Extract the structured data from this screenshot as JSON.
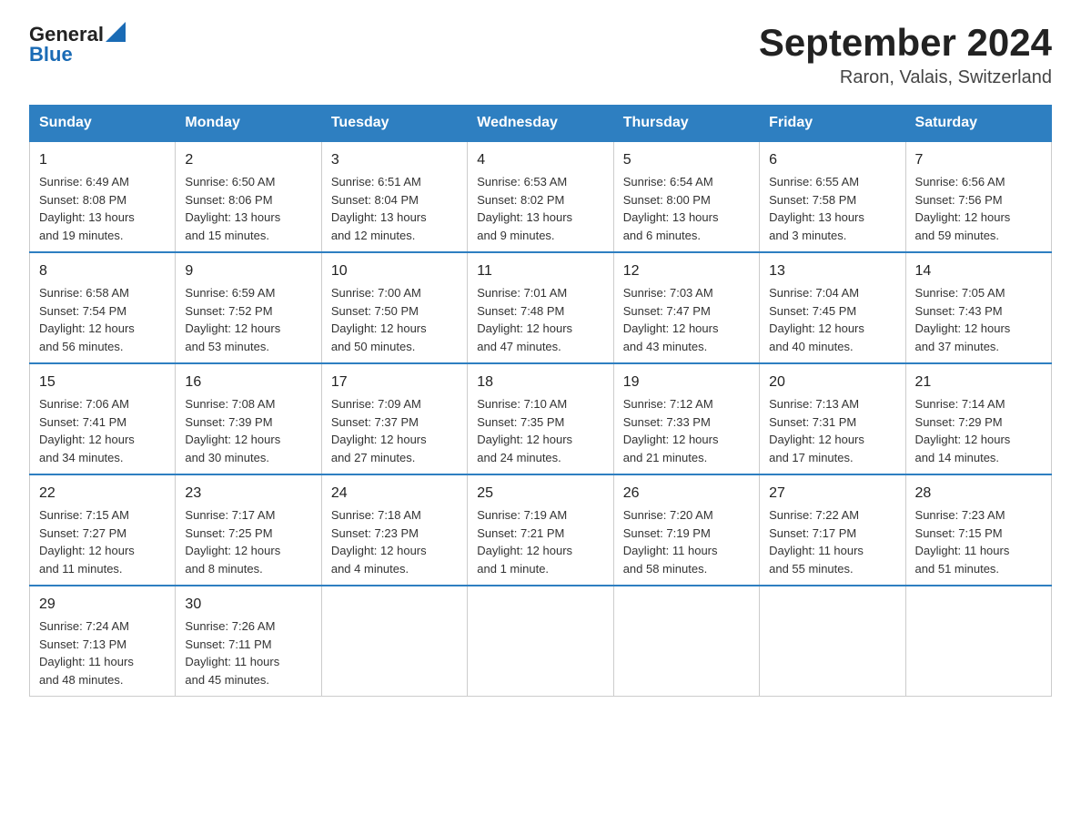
{
  "header": {
    "logo_text_black": "General",
    "logo_text_blue": "Blue",
    "title": "September 2024",
    "subtitle": "Raron, Valais, Switzerland"
  },
  "days_of_week": [
    "Sunday",
    "Monday",
    "Tuesday",
    "Wednesday",
    "Thursday",
    "Friday",
    "Saturday"
  ],
  "weeks": [
    [
      {
        "num": "1",
        "info": "Sunrise: 6:49 AM\nSunset: 8:08 PM\nDaylight: 13 hours\nand 19 minutes."
      },
      {
        "num": "2",
        "info": "Sunrise: 6:50 AM\nSunset: 8:06 PM\nDaylight: 13 hours\nand 15 minutes."
      },
      {
        "num": "3",
        "info": "Sunrise: 6:51 AM\nSunset: 8:04 PM\nDaylight: 13 hours\nand 12 minutes."
      },
      {
        "num": "4",
        "info": "Sunrise: 6:53 AM\nSunset: 8:02 PM\nDaylight: 13 hours\nand 9 minutes."
      },
      {
        "num": "5",
        "info": "Sunrise: 6:54 AM\nSunset: 8:00 PM\nDaylight: 13 hours\nand 6 minutes."
      },
      {
        "num": "6",
        "info": "Sunrise: 6:55 AM\nSunset: 7:58 PM\nDaylight: 13 hours\nand 3 minutes."
      },
      {
        "num": "7",
        "info": "Sunrise: 6:56 AM\nSunset: 7:56 PM\nDaylight: 12 hours\nand 59 minutes."
      }
    ],
    [
      {
        "num": "8",
        "info": "Sunrise: 6:58 AM\nSunset: 7:54 PM\nDaylight: 12 hours\nand 56 minutes."
      },
      {
        "num": "9",
        "info": "Sunrise: 6:59 AM\nSunset: 7:52 PM\nDaylight: 12 hours\nand 53 minutes."
      },
      {
        "num": "10",
        "info": "Sunrise: 7:00 AM\nSunset: 7:50 PM\nDaylight: 12 hours\nand 50 minutes."
      },
      {
        "num": "11",
        "info": "Sunrise: 7:01 AM\nSunset: 7:48 PM\nDaylight: 12 hours\nand 47 minutes."
      },
      {
        "num": "12",
        "info": "Sunrise: 7:03 AM\nSunset: 7:47 PM\nDaylight: 12 hours\nand 43 minutes."
      },
      {
        "num": "13",
        "info": "Sunrise: 7:04 AM\nSunset: 7:45 PM\nDaylight: 12 hours\nand 40 minutes."
      },
      {
        "num": "14",
        "info": "Sunrise: 7:05 AM\nSunset: 7:43 PM\nDaylight: 12 hours\nand 37 minutes."
      }
    ],
    [
      {
        "num": "15",
        "info": "Sunrise: 7:06 AM\nSunset: 7:41 PM\nDaylight: 12 hours\nand 34 minutes."
      },
      {
        "num": "16",
        "info": "Sunrise: 7:08 AM\nSunset: 7:39 PM\nDaylight: 12 hours\nand 30 minutes."
      },
      {
        "num": "17",
        "info": "Sunrise: 7:09 AM\nSunset: 7:37 PM\nDaylight: 12 hours\nand 27 minutes."
      },
      {
        "num": "18",
        "info": "Sunrise: 7:10 AM\nSunset: 7:35 PM\nDaylight: 12 hours\nand 24 minutes."
      },
      {
        "num": "19",
        "info": "Sunrise: 7:12 AM\nSunset: 7:33 PM\nDaylight: 12 hours\nand 21 minutes."
      },
      {
        "num": "20",
        "info": "Sunrise: 7:13 AM\nSunset: 7:31 PM\nDaylight: 12 hours\nand 17 minutes."
      },
      {
        "num": "21",
        "info": "Sunrise: 7:14 AM\nSunset: 7:29 PM\nDaylight: 12 hours\nand 14 minutes."
      }
    ],
    [
      {
        "num": "22",
        "info": "Sunrise: 7:15 AM\nSunset: 7:27 PM\nDaylight: 12 hours\nand 11 minutes."
      },
      {
        "num": "23",
        "info": "Sunrise: 7:17 AM\nSunset: 7:25 PM\nDaylight: 12 hours\nand 8 minutes."
      },
      {
        "num": "24",
        "info": "Sunrise: 7:18 AM\nSunset: 7:23 PM\nDaylight: 12 hours\nand 4 minutes."
      },
      {
        "num": "25",
        "info": "Sunrise: 7:19 AM\nSunset: 7:21 PM\nDaylight: 12 hours\nand 1 minute."
      },
      {
        "num": "26",
        "info": "Sunrise: 7:20 AM\nSunset: 7:19 PM\nDaylight: 11 hours\nand 58 minutes."
      },
      {
        "num": "27",
        "info": "Sunrise: 7:22 AM\nSunset: 7:17 PM\nDaylight: 11 hours\nand 55 minutes."
      },
      {
        "num": "28",
        "info": "Sunrise: 7:23 AM\nSunset: 7:15 PM\nDaylight: 11 hours\nand 51 minutes."
      }
    ],
    [
      {
        "num": "29",
        "info": "Sunrise: 7:24 AM\nSunset: 7:13 PM\nDaylight: 11 hours\nand 48 minutes."
      },
      {
        "num": "30",
        "info": "Sunrise: 7:26 AM\nSunset: 7:11 PM\nDaylight: 11 hours\nand 45 minutes."
      },
      null,
      null,
      null,
      null,
      null
    ]
  ]
}
